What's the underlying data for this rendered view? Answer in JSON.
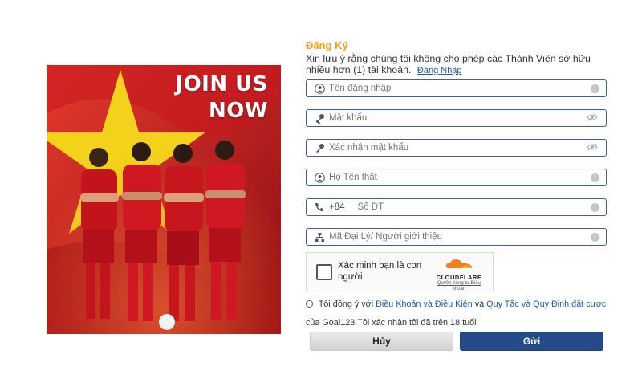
{
  "banner": {
    "line1": "JOIN US",
    "line2": "NOW",
    "colors": {
      "red": "#c8181f",
      "star": "#f4d21c"
    }
  },
  "form": {
    "title": "Đăng Ký",
    "notice": "Xin lưu ý rằng chúng tôi không cho phép các Thành Viên sở hữu nhiều hơn (1) tài khoản.",
    "login_link": "Đăng Nhập",
    "fields": {
      "username": {
        "placeholder": "Tên đăng nhập",
        "icon": "user-icon"
      },
      "password": {
        "placeholder": "Mật khẩu",
        "icon": "key-icon"
      },
      "confirm": {
        "placeholder": "Xác nhận mật khẩu",
        "icon": "key-icon"
      },
      "fullname": {
        "placeholder": "Họ Tên thật",
        "icon": "user-icon"
      },
      "phone": {
        "prefix": "+84",
        "placeholder": "Số ĐT",
        "icon": "phone-icon"
      },
      "agent": {
        "placeholder": "Mã Đại Lý/ Người giới thiệu",
        "icon": "network-icon"
      }
    }
  },
  "captcha": {
    "label": "Xác minh bạn là con người",
    "brand": "CLOUDFLARE",
    "links": "Quyền riêng tư Điều khoản"
  },
  "agree": {
    "prefix": "Tôi đồng ý với",
    "terms": "Điều Khoản và Điều Kiện",
    "and": "và",
    "rules": "Quy Tắc và Quy Định đặt cược",
    "suffix": "của Goal123.Tôi xác nhận tôi đã trên 18 tuổi"
  },
  "buttons": {
    "cancel": "Hủy",
    "submit": "Gửi"
  },
  "colors": {
    "accent_blue": "#2f5fbf",
    "title_orange": "#f0a21a",
    "submit_bg": "#254a8a"
  }
}
